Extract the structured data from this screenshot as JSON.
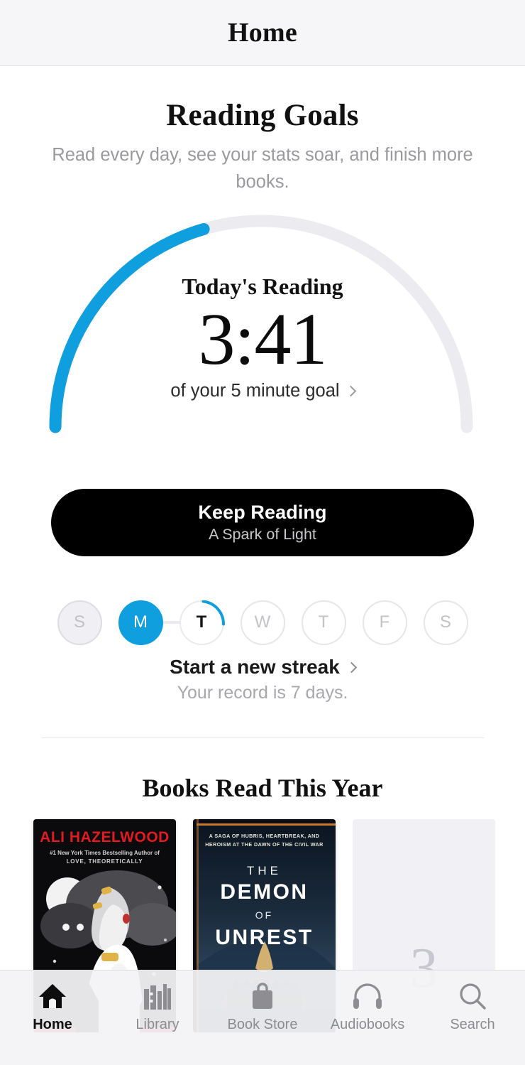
{
  "header": {
    "title": "Home"
  },
  "goals": {
    "title": "Reading Goals",
    "subtitle": "Read every day, see your stats soar, and finish more books."
  },
  "progress": {
    "label": "Today's Reading",
    "value": "3:41",
    "goal_text": "of your 5 minute goal",
    "chevron": "chevron-right-icon",
    "percent": 41,
    "track_color": "#ecebf0",
    "fill_color": "#0f9ede"
  },
  "keep_reading": {
    "title": "Keep Reading",
    "book": "A Spark of Light"
  },
  "streak": {
    "days": [
      {
        "letter": "S",
        "state": "done-gray"
      },
      {
        "letter": "M",
        "state": "active"
      },
      {
        "letter": "T",
        "state": "today"
      },
      {
        "letter": "W",
        "state": "empty"
      },
      {
        "letter": "T",
        "state": "empty"
      },
      {
        "letter": "F",
        "state": "empty"
      },
      {
        "letter": "S",
        "state": "empty"
      }
    ],
    "cta": "Start a new streak",
    "chevron": "chevron-right-icon",
    "record": "Your record is 7 days."
  },
  "books_section": {
    "title": "Books Read This Year",
    "covers": [
      {
        "author": "ALI HAZELWOOD",
        "byline_1": "#1 New York Times Bestselling Author of",
        "byline_2": "LOVE, THEORETICALLY",
        "alt": "book-cover-ali-hazelwood"
      },
      {
        "tagline": "A SAGA OF HUBRIS, HEARTBREAK, AND HEROISM AT THE DAWN OF THE CIVIL WAR",
        "title_1": "THE",
        "title_2": "DEMON",
        "title_3": "OF",
        "title_4": "UNREST",
        "alt": "book-cover-the-demon-of-unrest"
      },
      {
        "placeholder_number": "3",
        "alt": "book-placeholder-three"
      }
    ]
  },
  "tabs": [
    {
      "label": "Home",
      "icon": "home-icon",
      "active": true
    },
    {
      "label": "Library",
      "icon": "books-icon",
      "active": false
    },
    {
      "label": "Book Store",
      "icon": "bag-icon",
      "active": false
    },
    {
      "label": "Audiobooks",
      "icon": "headphones-icon",
      "active": false
    },
    {
      "label": "Search",
      "icon": "search-icon",
      "active": false
    }
  ]
}
